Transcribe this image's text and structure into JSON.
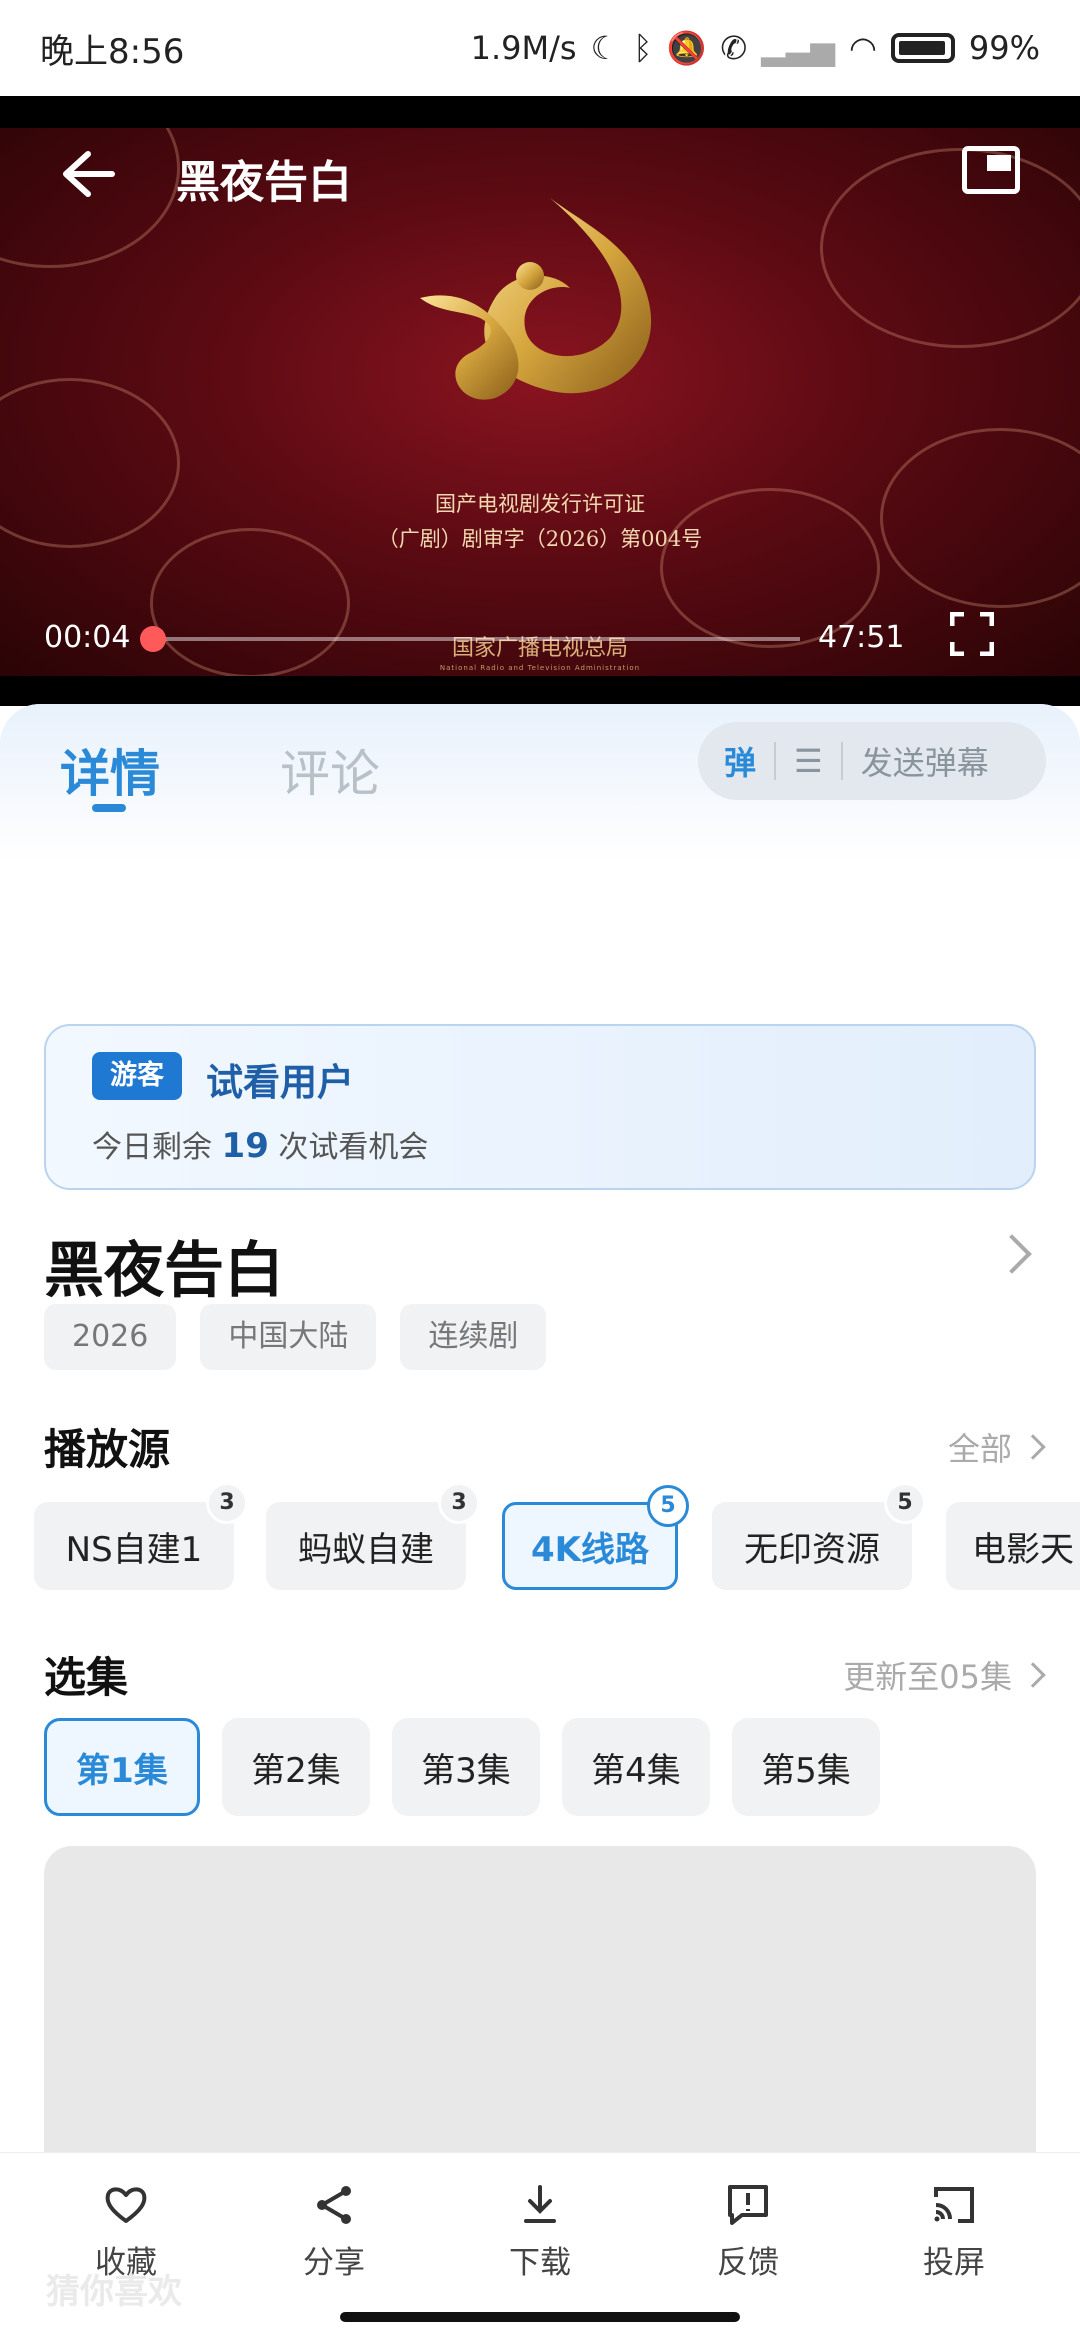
{
  "status_bar": {
    "time": "晚上8:56",
    "net_speed": "1.9M/s",
    "battery": "99%"
  },
  "player": {
    "title": "黑夜告白",
    "license_line1": "国产电视剧发行许可证",
    "license_line2": "（广剧）剧审字（2026）第004号",
    "bureau_cn": "国家广播电视总局",
    "bureau_en": "National Radio and Television Administration",
    "current_time": "00:04",
    "duration": "47:51",
    "progress": 0.0014
  },
  "tabs": {
    "details": "详情",
    "comments": "评论"
  },
  "danmaku": {
    "toggle_label": "弹",
    "send_label": "发送弹幕"
  },
  "trial": {
    "badge": "游客",
    "user_label": "试看用户",
    "prefix": "今日剩余",
    "count": "19",
    "suffix": "次试看机会"
  },
  "drama": {
    "title": "黑夜告白",
    "tags": [
      "2026",
      "中国大陆",
      "连续剧"
    ]
  },
  "sources": {
    "heading": "播放源",
    "more": "全部",
    "items": [
      {
        "label": "NS自建1",
        "count": "3"
      },
      {
        "label": "蚂蚁自建",
        "count": "3"
      },
      {
        "label": "4K线路",
        "count": "5"
      },
      {
        "label": "无印资源",
        "count": "5"
      },
      {
        "label": "电影天"
      }
    ],
    "selected": 2
  },
  "episodes": {
    "heading": "选集",
    "update": "更新至05集",
    "items": [
      "第1集",
      "第2集",
      "第3集",
      "第4集",
      "第5集"
    ],
    "selected": 0
  },
  "bottom_bar": {
    "favorite": "收藏",
    "share": "分享",
    "download": "下载",
    "feedback": "反馈",
    "cast": "投屏"
  },
  "hidden_section_label": "猜你喜欢",
  "colors": {
    "accent": "#2a8ad8",
    "trial_text": "#1e5fa8",
    "progress_knob": "#ff5a5a"
  }
}
